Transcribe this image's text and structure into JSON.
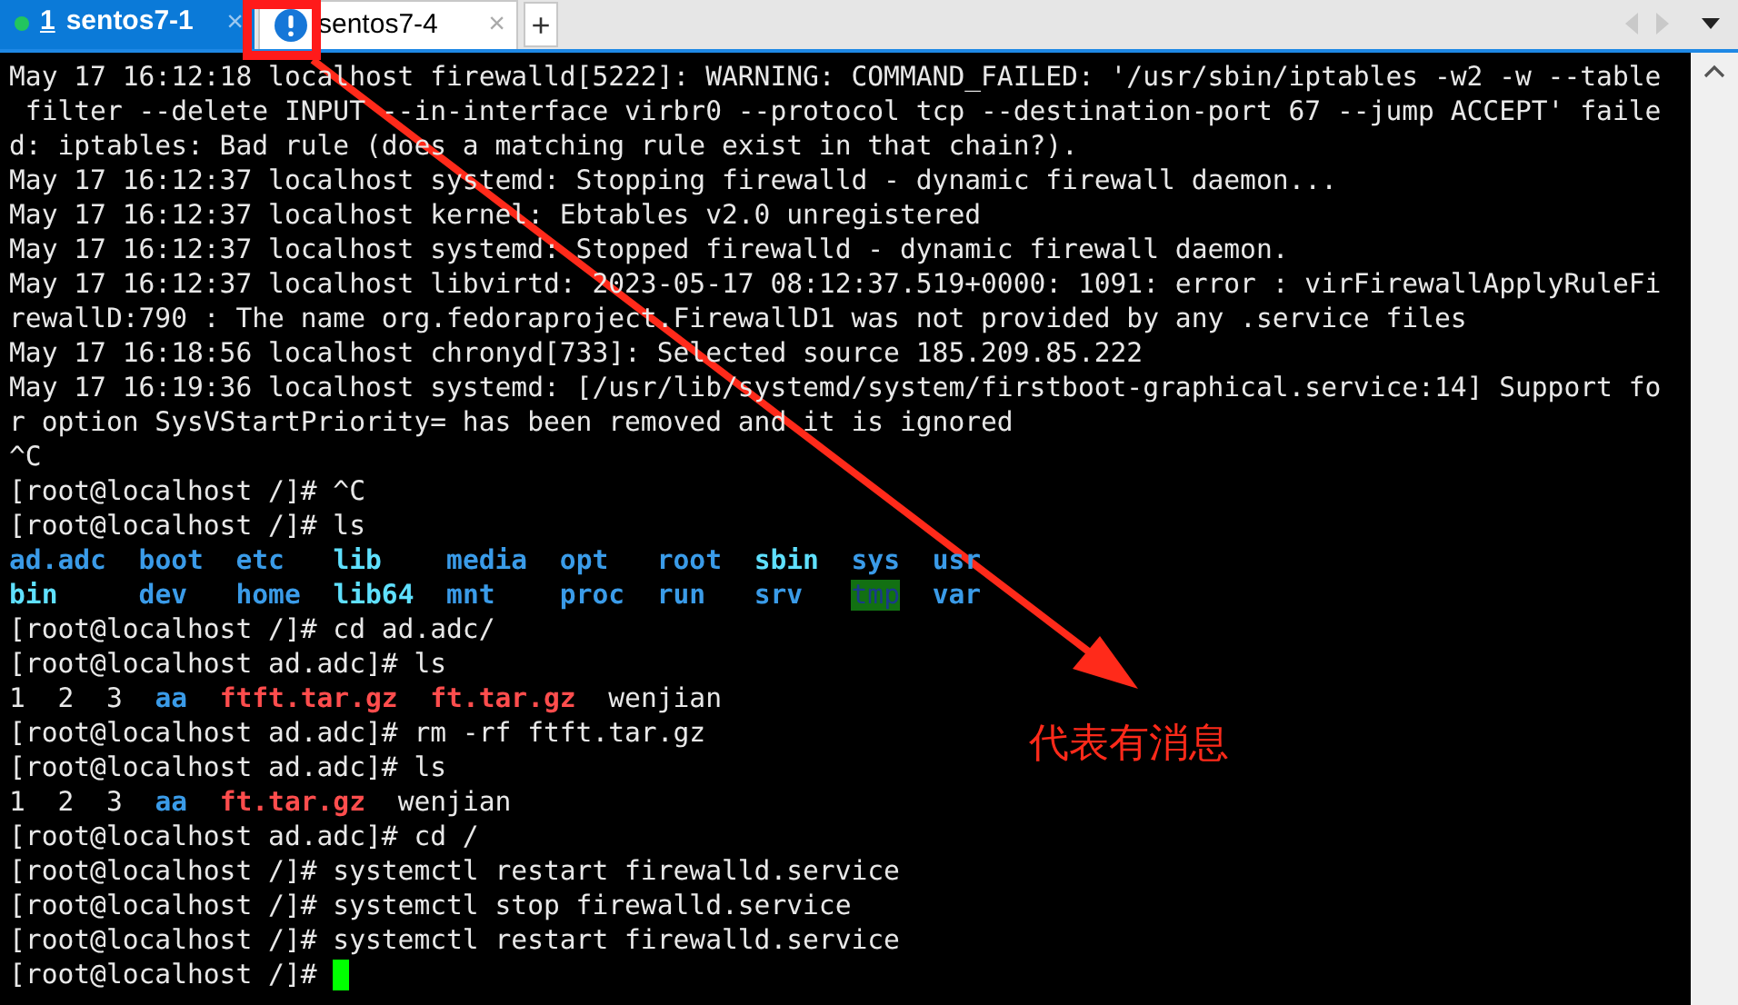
{
  "tabs": [
    {
      "number": "1",
      "label": "sentos7-1",
      "selected": true,
      "connected": true,
      "has_message": false,
      "close": "×"
    },
    {
      "label": "sentos7-4",
      "selected": false,
      "connected": false,
      "has_message": true,
      "close": "×"
    }
  ],
  "new_tab": "+",
  "terminal": {
    "lines": [
      [
        {
          "text": "May 17 16:12:18 localhost firewalld[5222]: WARNING: COMMAND_FAILED: '/usr/sbin/iptables -w2 -w --table",
          "kind": "plain"
        }
      ],
      [
        {
          "text": " filter --delete INPUT --in-interface virbr0 --protocol tcp --destination-port 67 --jump ACCEPT' faile",
          "kind": "plain"
        }
      ],
      [
        {
          "text": "d: iptables: Bad rule (does a matching rule exist in that chain?).",
          "kind": "plain"
        }
      ],
      [
        {
          "text": "May 17 16:12:37 localhost systemd: Stopping firewalld - dynamic firewall daemon...",
          "kind": "plain"
        }
      ],
      [
        {
          "text": "May 17 16:12:37 localhost kernel: Ebtables v2.0 unregistered",
          "kind": "plain"
        }
      ],
      [
        {
          "text": "May 17 16:12:37 localhost systemd: Stopped firewalld - dynamic firewall daemon.",
          "kind": "plain"
        }
      ],
      [
        {
          "text": "May 17 16:12:37 localhost libvirtd: 2023-05-17 08:12:37.519+0000: 1091: error : virFirewallApplyRuleFi",
          "kind": "plain"
        }
      ],
      [
        {
          "text": "rewallD:790 : The name org.fedoraproject.FirewallD1 was not provided by any .service files",
          "kind": "plain"
        }
      ],
      [
        {
          "text": "May 17 16:18:56 localhost chronyd[733]: Selected source 185.209.85.222",
          "kind": "plain"
        }
      ],
      [
        {
          "text": "May 17 16:19:36 localhost systemd: [/usr/lib/systemd/system/firstboot-graphical.service:14] Support fo",
          "kind": "plain"
        }
      ],
      [
        {
          "text": "r option SysVStartPriority= has been removed and it is ignored",
          "kind": "plain"
        }
      ],
      [
        {
          "text": "^C",
          "kind": "plain"
        }
      ],
      [
        {
          "text": "[root@localhost /]# ^C",
          "kind": "plain"
        }
      ],
      [
        {
          "text": "[root@localhost /]# ls",
          "kind": "plain"
        }
      ],
      [
        {
          "text": "ad.adc  ",
          "kind": "dir"
        },
        {
          "text": "boot  ",
          "kind": "dir"
        },
        {
          "text": "etc   ",
          "kind": "dir"
        },
        {
          "text": "lib    ",
          "kind": "link"
        },
        {
          "text": "media  ",
          "kind": "dir"
        },
        {
          "text": "opt   ",
          "kind": "dir"
        },
        {
          "text": "root  ",
          "kind": "dir"
        },
        {
          "text": "sbin  ",
          "kind": "link"
        },
        {
          "text": "sys  ",
          "kind": "dir"
        },
        {
          "text": "usr",
          "kind": "dir"
        }
      ],
      [
        {
          "text": "bin     ",
          "kind": "link"
        },
        {
          "text": "dev   ",
          "kind": "dir"
        },
        {
          "text": "home  ",
          "kind": "dir"
        },
        {
          "text": "lib64  ",
          "kind": "link"
        },
        {
          "text": "mnt    ",
          "kind": "dir"
        },
        {
          "text": "proc  ",
          "kind": "dir"
        },
        {
          "text": "run   ",
          "kind": "dir"
        },
        {
          "text": "srv   ",
          "kind": "dir"
        },
        {
          "text": "tmp",
          "kind": "sticky"
        },
        {
          "text": "  var",
          "kind": "dir"
        }
      ],
      [
        {
          "text": "[root@localhost /]# cd ad.adc/",
          "kind": "plain"
        }
      ],
      [
        {
          "text": "[root@localhost ad.adc]# ls",
          "kind": "plain"
        }
      ],
      [
        {
          "text": "1  2  3  ",
          "kind": "plain"
        },
        {
          "text": "aa  ",
          "kind": "dir"
        },
        {
          "text": "ftft.tar.gz  ",
          "kind": "archive"
        },
        {
          "text": "ft.tar.gz  ",
          "kind": "archive"
        },
        {
          "text": "wenjian",
          "kind": "plain"
        }
      ],
      [
        {
          "text": "[root@localhost ad.adc]# rm -rf ftft.tar.gz",
          "kind": "plain"
        }
      ],
      [
        {
          "text": "[root@localhost ad.adc]# ls",
          "kind": "plain"
        }
      ],
      [
        {
          "text": "1  2  3  ",
          "kind": "plain"
        },
        {
          "text": "aa  ",
          "kind": "dir"
        },
        {
          "text": "ft.tar.gz  ",
          "kind": "archive"
        },
        {
          "text": "wenjian",
          "kind": "plain"
        }
      ],
      [
        {
          "text": "[root@localhost ad.adc]# cd /",
          "kind": "plain"
        }
      ],
      [
        {
          "text": "[root@localhost /]# systemctl restart firewalld.service",
          "kind": "plain"
        }
      ],
      [
        {
          "text": "[root@localhost /]# systemctl stop firewalld.service",
          "kind": "plain"
        }
      ],
      [
        {
          "text": "[root@localhost /]# systemctl restart firewalld.service",
          "kind": "plain"
        }
      ],
      [
        {
          "text": "[root@localhost /]# ",
          "kind": "plain",
          "cursor": true
        }
      ]
    ]
  },
  "annotation": {
    "text": "代表有消息"
  }
}
